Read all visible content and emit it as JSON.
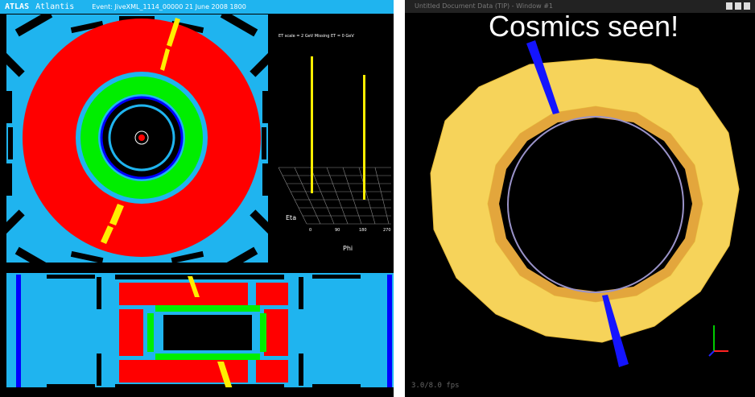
{
  "atlas": {
    "app_name": "ATLAS",
    "app_subtitle": "Atlantis",
    "event_info": "Event: JiveXML_1114_00000  21 June 2008  1800",
    "lego": {
      "scale_text": "ET scale = 2 GeV  Missing ET = 0 GeV",
      "eta_label": "Eta",
      "phi_label": "Phi",
      "phi_ticks": [
        "0",
        "90",
        "180",
        "270"
      ]
    },
    "colors": {
      "titlebar": "#1fb4ef",
      "calorimeter_outer": "#ff0000",
      "calorimeter_inner": "#00ee00",
      "muon_background": "#1fb4ef",
      "tracker": "#0000ff",
      "cosmic_track": "#ffee00"
    }
  },
  "gl_window": {
    "title": "Untitled Document Data (TIP) - Window #1",
    "heading": "Cosmics seen!",
    "fps": "3.0/8.0 fps",
    "axes_icon": "xyz-axes-icon",
    "colors": {
      "barrel": "#f6d35a",
      "barrel_inner": "#e3a63c",
      "muon_track": "#1414ff"
    }
  }
}
